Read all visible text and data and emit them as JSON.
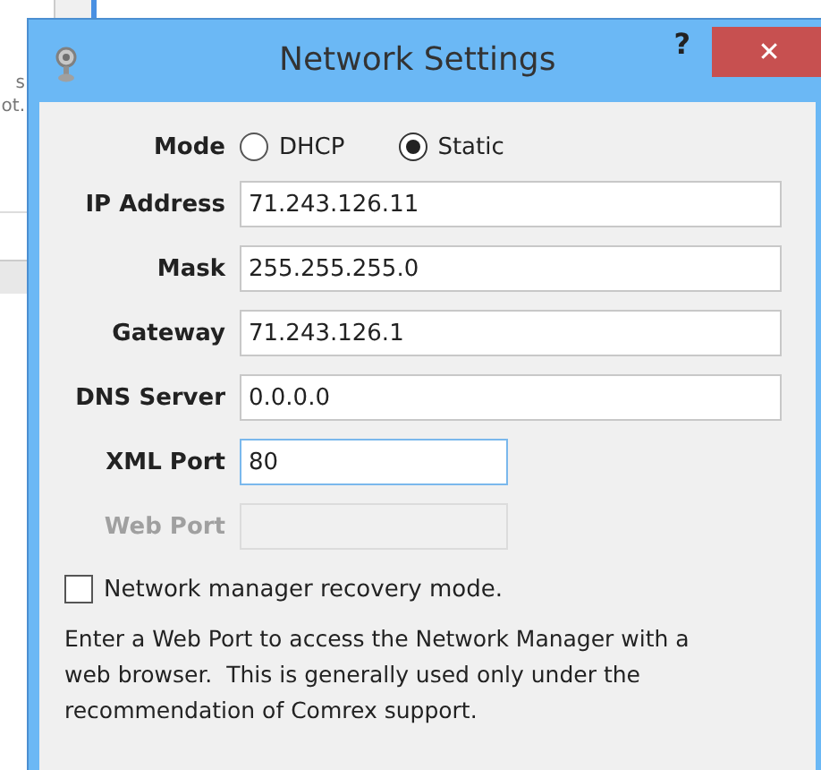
{
  "background_texts": [
    "s",
    "ot."
  ],
  "window": {
    "title": "Network Settings",
    "help_button": "?",
    "close_button": "✕"
  },
  "mode": {
    "label": "Mode",
    "options": [
      {
        "label": "DHCP",
        "selected": false
      },
      {
        "label": "Static",
        "selected": true
      }
    ]
  },
  "fields": [
    {
      "label": "IP Address",
      "value": "71.243.126.11",
      "disabled": false,
      "focused": false,
      "kind": "wide"
    },
    {
      "label": "Mask",
      "value": "255.255.255.0",
      "disabled": false,
      "focused": false,
      "kind": "wide"
    },
    {
      "label": "Gateway",
      "value": "71.243.126.1",
      "disabled": false,
      "focused": false,
      "kind": "wide"
    },
    {
      "label": "DNS Server",
      "value": "0.0.0.0",
      "disabled": false,
      "focused": false,
      "kind": "wide"
    },
    {
      "label": "XML Port",
      "value": "80",
      "disabled": false,
      "focused": true,
      "kind": "short"
    },
    {
      "label": "Web Port",
      "disabled": true,
      "focused": false,
      "kind": "short"
    }
  ],
  "recovery_checkbox": {
    "label": "Network manager recovery mode.",
    "checked": false
  },
  "note": "Enter a Web Port to access the Network Manager with a web browser.  This is generally used only under the recommendation of Comrex support."
}
